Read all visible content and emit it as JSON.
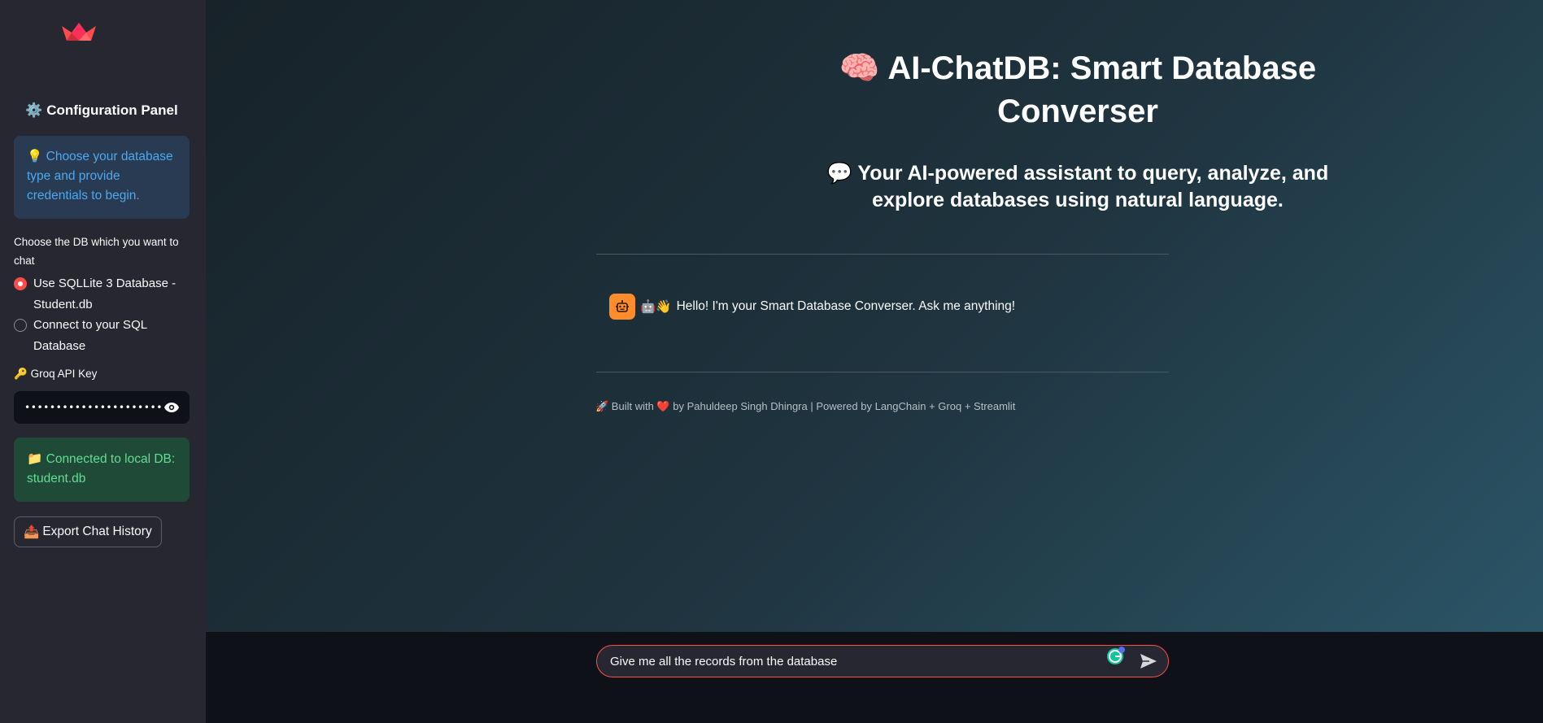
{
  "sidebar": {
    "logo_icon": "streamlit-crown-icon",
    "config_icon": "⚙️",
    "config_title": "Configuration Panel",
    "info_icon": "💡",
    "info_text": "Choose your database type and provide credentials to begin.",
    "db_label": "Choose the DB which you want to chat",
    "db_options": [
      {
        "label": "Use SQLLite 3 Database - Student.db",
        "selected": true
      },
      {
        "label": "Connect to your SQL Database",
        "selected": false
      }
    ],
    "api_icon": "🔑",
    "api_label": "Groq API Key",
    "api_value": "••••••••••••••••••••••••••••••••••",
    "success_icon": "📁",
    "success_text": "Connected to local DB: student.db",
    "export_icon": "📤",
    "export_label": "Export Chat History"
  },
  "main": {
    "title_icon": "🧠",
    "title": "AI-ChatDB: Smart Database Converser",
    "subtitle_icon": "💬",
    "subtitle": "Your AI-powered assistant to query, analyze, and explore databases using natural language.",
    "chat_message_icon": "🤖👋",
    "chat_message": "Hello! I'm your Smart Database Converser. Ask me anything!",
    "footer_note": "🚀 Built with ❤️ by Pahuldeep Singh Dhingra | Powered by LangChain + Groq + Streamlit"
  },
  "chat_input": {
    "value": "Give me all the records from the database"
  },
  "colors": {
    "accent": "#ff4b4b",
    "sidebar_bg": "#262730",
    "info_bg": "#283b52",
    "info_text": "#4ea8ee",
    "success_bg": "#1f4a38",
    "success_text": "#62dd92",
    "bot_avatar": "#ff8c2b"
  }
}
